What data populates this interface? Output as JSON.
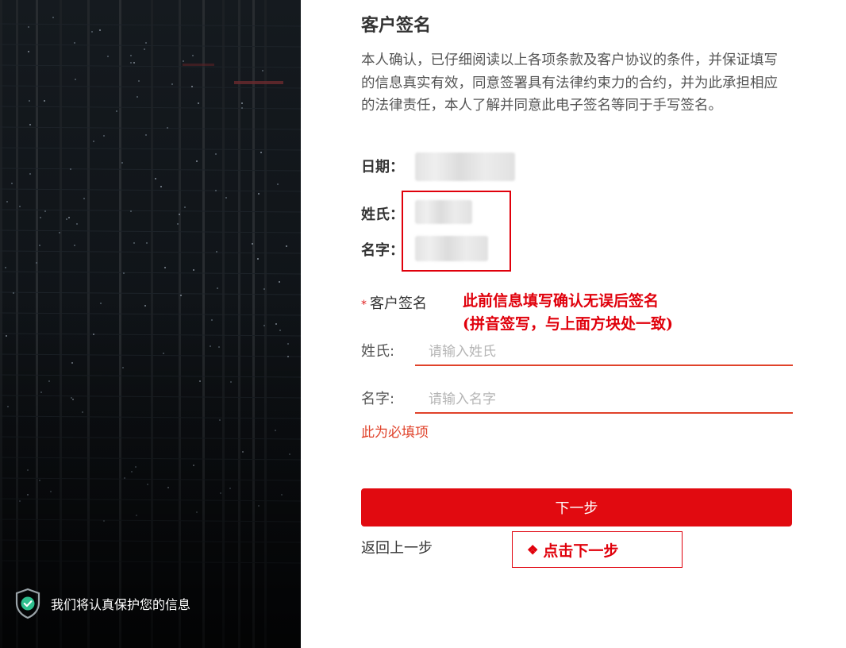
{
  "left_panel": {
    "secure_text": "我们将认真保护您的信息",
    "secure_icon": "shield-check-icon",
    "accent": "#2fbf8e"
  },
  "form": {
    "title": "客户签名",
    "consent": "本人确认，已仔细阅读以上各项条款及客户协议的条件，并保证填写的信息真实有效，同意签署具有法律约束力的合约，并为此承担相应的法律责任，本人了解并同意此电子签名等同于手写签名。",
    "date_label": "日期：",
    "surname_label": "姓氏：",
    "givenname_label": "名字：",
    "signature": {
      "required_mark": "*",
      "label": "客户签名"
    },
    "surname_field": {
      "label": "姓氏:",
      "placeholder": "请输入姓氏",
      "value": ""
    },
    "givenname_field": {
      "label": "名字:",
      "placeholder": "请输入名字",
      "value": ""
    },
    "error": "此为必填项",
    "next_button": "下一步",
    "back_link": "返回上一步"
  },
  "annotations": {
    "note_line1": "此前信息填写确认无误后签名",
    "note_line2": "(拼音签写，与上面方块处一致)",
    "callout_symbol": "❖",
    "callout_text": "点击下一步"
  },
  "colors": {
    "brand_red": "#e10a10",
    "annotation_red": "#e0000b",
    "input_underline": "#e0422a"
  }
}
